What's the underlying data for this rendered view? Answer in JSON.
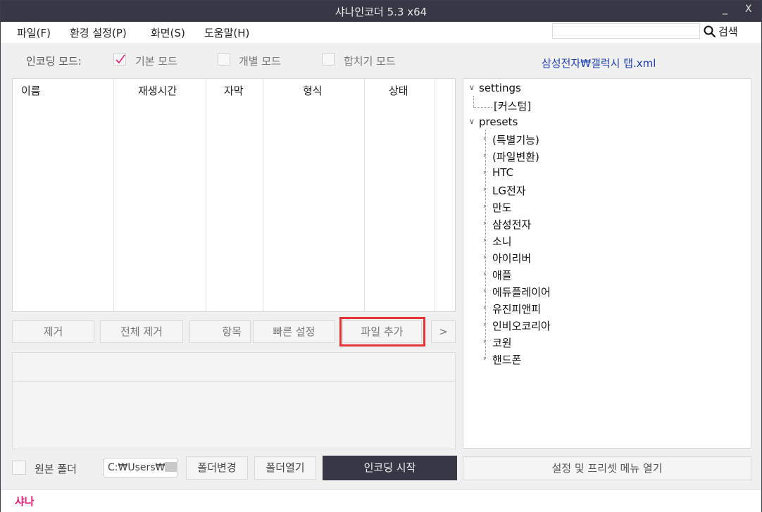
{
  "window": {
    "title": "샤나인코더  5.3  x64",
    "minimize": "_",
    "close": "X"
  },
  "menu": [
    "파일(F)",
    "환경 설정(P)",
    "화면(S)",
    "도움말(H)"
  ],
  "search": {
    "placeholder": "",
    "button": "검색"
  },
  "encoding_mode": {
    "label": "인코딩 모드:",
    "options": [
      {
        "label": "기본 모드",
        "checked": true
      },
      {
        "label": "개별 모드",
        "checked": false
      },
      {
        "label": "합치기 모드",
        "checked": false
      }
    ]
  },
  "preset_path": "삼성전자₩갤럭시 탭.xml",
  "file_table": {
    "columns": [
      "이름",
      "재생시간",
      "자막",
      "형식",
      "상태"
    ],
    "rows": []
  },
  "list_buttons": {
    "remove": "제거",
    "remove_all": "전체 제거",
    "items": "항목",
    "quick_settings": "빠른 설정",
    "add_file": "파일 추가",
    "more": ">"
  },
  "tree": {
    "settings": {
      "label": "settings",
      "children": [
        "[커스텀]"
      ]
    },
    "presets": {
      "label": "presets",
      "children": [
        "(특별기능)",
        "(파일변환)",
        "HTC",
        "LG전자",
        "만도",
        "삼성전자",
        "소니",
        "아이리버",
        "애플",
        "에듀플레이어",
        "유진피앤피",
        "인비오코리아",
        "코원",
        "핸드폰"
      ]
    }
  },
  "bottom": {
    "source_folder_label": "원본 폴더",
    "folder_path": "C:₩Users₩",
    "change_folder": "폴더변경",
    "open_folder": "폴더열기",
    "start_encoding": "인코딩 시작",
    "open_settings": "설정 및 프리셋 메뉴 열기"
  },
  "status": {
    "brand": "샤나"
  },
  "colors": {
    "titlebar": "#363945",
    "accent_pink": "#e0207a",
    "path_blue": "#1e3fb0",
    "highlight_red": "#e5333a"
  }
}
